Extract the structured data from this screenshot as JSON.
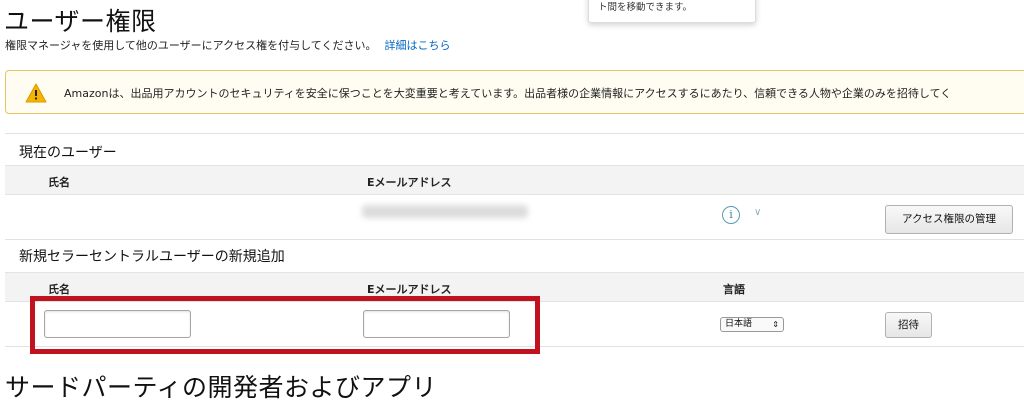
{
  "header": {
    "title": "ユーザー権限",
    "subtitle": "権限マネージャを使用して他のユーザーにアクセス権を付与してください。",
    "details_link": "詳細はこちら"
  },
  "tooltip": {
    "text": "ト間を移動できます。"
  },
  "alert": {
    "icon": "warning-icon",
    "color": "#f5b400",
    "text": "Amazonは、出品用アカウントのセキュリティを安全に保つことを大変重要と考えています。出品者様の企業情報にアクセスするにあたり、信頼できる人物や企業のみを招待してく"
  },
  "current_users": {
    "title": "現在のユーザー",
    "columns": [
      "氏名",
      "Eメールアドレス"
    ],
    "rows": [
      {
        "name": "",
        "email": "",
        "info_icon": "info-icon",
        "chevron_icon": "chevron-down-icon",
        "manage_button": "アクセス権限の管理"
      }
    ]
  },
  "add_user": {
    "title": "新規セラーセントラルユーザーの新規追加",
    "columns": [
      "氏名",
      "Eメールアドレス",
      "言語"
    ],
    "name_value": "",
    "email_value": "",
    "language_selected": "日本語",
    "invite_button": "招待"
  },
  "third_party": {
    "title": "サードパーティの開発者およびアプリ"
  },
  "colors": {
    "link": "#0066c0",
    "highlight": "#c1121f",
    "alert_border": "#e5c56a"
  }
}
